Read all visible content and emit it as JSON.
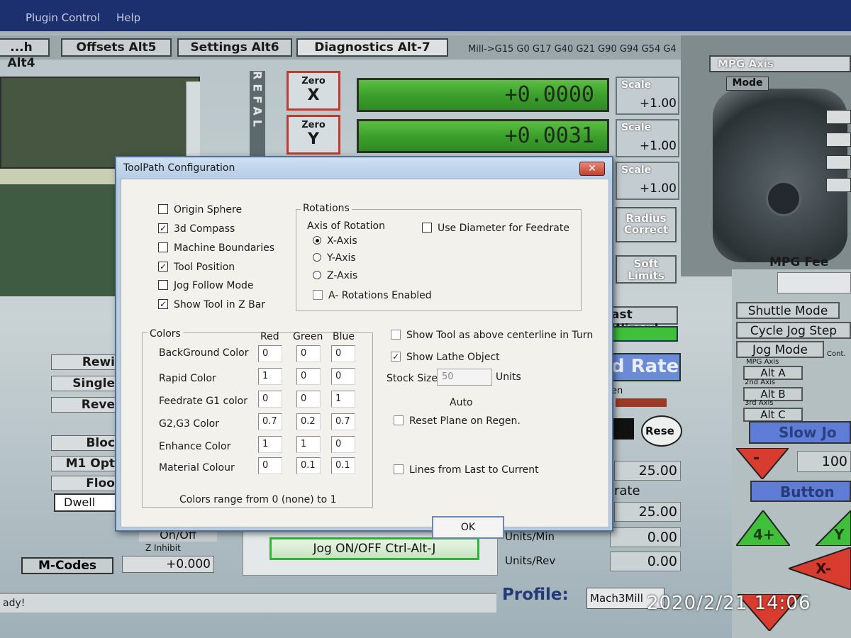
{
  "menu": {
    "plugin_control": "Plugin Control",
    "help": "Help"
  },
  "tabs": [
    {
      "label": "...h Alt4"
    },
    {
      "label": "Offsets Alt5"
    },
    {
      "label": "Settings Alt6"
    },
    {
      "label": "Diagnostics Alt-7"
    }
  ],
  "gcode_status": "Mill->G15  G0 G17 G40 G21 G90 G94 G54 G4",
  "ref_strip": "REFAL",
  "dro": {
    "zero_x": {
      "top": "Zero",
      "axis": "X"
    },
    "zero_y": {
      "top": "Zero",
      "axis": "Y"
    },
    "x_value": "+0.0000",
    "y_value": "+0.0031"
  },
  "scale": {
    "label": "Scale",
    "values": [
      "+1.00",
      "+1.00",
      "+1.00"
    ]
  },
  "side_buttons": {
    "radius_correct": "Radius Correct",
    "soft_limits": "Soft Limits",
    "last_wizard": "ast Wizard"
  },
  "mpg": {
    "title": "MPG Axis",
    "mode": "Mode",
    "feed": "MPG Fee"
  },
  "right_panel": {
    "shuttle_mode": "Shuttle Mode",
    "cycle_jog_step": "Cycle Jog Step",
    "jog_mode": "Jog Mode",
    "cont": "Cont.",
    "mpg_axis_lbl": "MPG Axis",
    "alt_a": "Alt A",
    "second_axis": "2nd Axis",
    "alt_b": "Alt B",
    "third_axis": "3rd Axis",
    "alt_c": "Alt C",
    "slow_jog": "Slow Jo",
    "jog_value": "100",
    "button": "Button",
    "jog_4plus": "4+",
    "jog_y": "Y",
    "jog_xminus": "X-",
    "jog_minus": "-"
  },
  "feed": {
    "d_rate": "d Rate",
    "en": "en",
    "reset": "Rese",
    "rate": "rate",
    "value1": "25.00",
    "value2": "25.00",
    "units_min_label": "Units/Min",
    "units_min_value": "0.00",
    "units_rev_label": "Units/Rev",
    "units_rev_value": "0.00"
  },
  "left_buttons": [
    "Rewi",
    "Single",
    "Reve",
    "Bloc",
    "M1 Opt",
    "Floo"
  ],
  "dwell": "Dwell",
  "m_codes": "M-Codes",
  "on_off": "On/Off",
  "z_inhibit": {
    "label": "Z Inhibit",
    "value": "+0.000"
  },
  "jog_toggle": "Jog ON/OFF Ctrl-Alt-J",
  "status_text": "ady!",
  "profile": {
    "label": "Profile:",
    "value": "Mach3Mill"
  },
  "timestamp": "2020/2/21  14:06",
  "dialog": {
    "title": "ToolPath Configuration",
    "close": "✕",
    "options": [
      {
        "label": "Origin Sphere",
        "checked": false
      },
      {
        "label": "3d Compass",
        "checked": true
      },
      {
        "label": "Machine Boundaries",
        "checked": false
      },
      {
        "label": "Tool Position",
        "checked": true
      },
      {
        "label": "Jog Follow Mode",
        "checked": false
      },
      {
        "label": "Show Tool in Z Bar",
        "checked": true
      }
    ],
    "rotations": {
      "title": "Rotations",
      "axis_label": "Axis of Rotation",
      "axes": [
        {
          "label": "X-Axis",
          "selected": true
        },
        {
          "label": "Y-Axis",
          "selected": false
        },
        {
          "label": "Z-Axis",
          "selected": false
        }
      ],
      "use_diameter": "Use Diameter for Feedrate",
      "a_rotations": "A- Rotations Enabled"
    },
    "colors": {
      "title": "Colors",
      "headers": [
        "Red",
        "Green",
        "Blue"
      ],
      "rows": [
        {
          "label": "BackGround Color",
          "values": [
            "0",
            "0",
            "0"
          ]
        },
        {
          "label": "Rapid Color",
          "values": [
            "1",
            "0",
            "0"
          ]
        },
        {
          "label": "Feedrate G1 color",
          "values": [
            "0",
            "0",
            "1"
          ]
        },
        {
          "label": "G2,G3 Color",
          "values": [
            "0.7",
            "0.2",
            "0.7"
          ]
        },
        {
          "label": "Enhance Color",
          "values": [
            "1",
            "1",
            "0"
          ]
        },
        {
          "label": "Material Colour",
          "values": [
            "0",
            "0.1",
            "0.1"
          ]
        }
      ],
      "range_note": "Colors range from 0 (none) to 1"
    },
    "lathe": {
      "show_tool_above": "Show Tool as above centerline in Turn",
      "show_tool_above_checked": false,
      "show_lathe_object": "Show Lathe Object",
      "show_lathe_object_checked": true,
      "stock_size_label": "Stock Size",
      "stock_size_value": "50",
      "units": "Units",
      "auto": "Auto",
      "reset_plane": "Reset Plane on Regen.",
      "lines_from_last": "Lines from Last to Current"
    },
    "ok": "OK"
  }
}
